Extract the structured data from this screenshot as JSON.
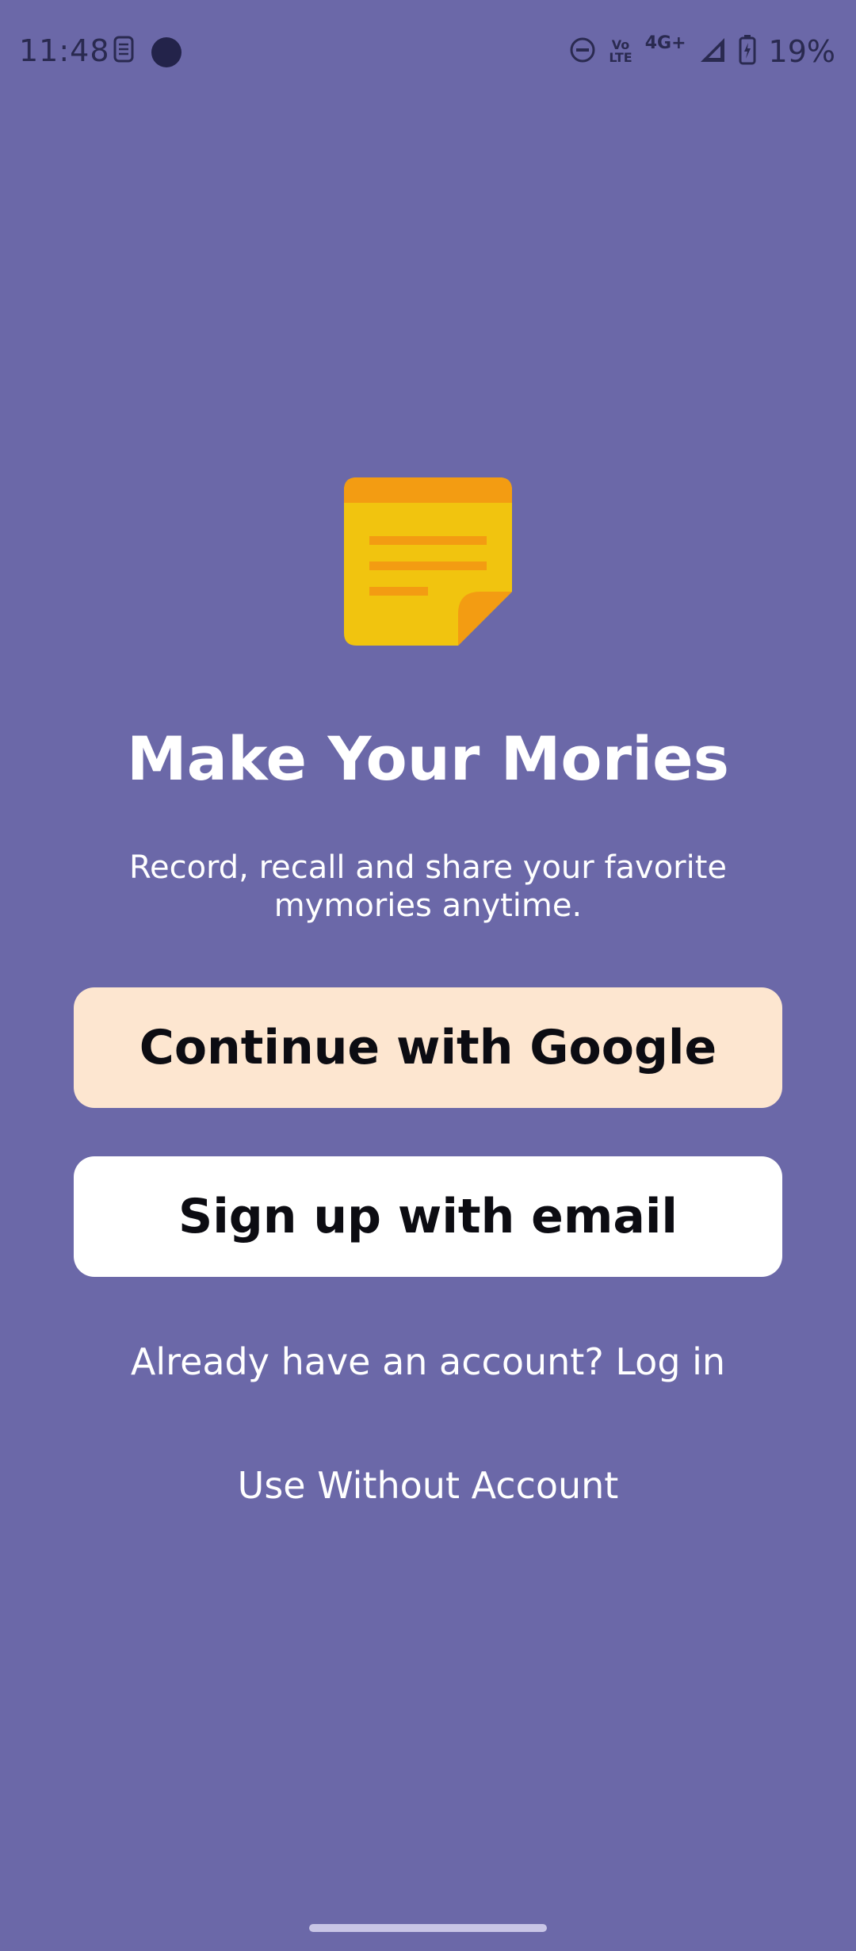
{
  "status_bar": {
    "time": "11:48",
    "network": "4G+",
    "volte_line1": "Vo",
    "volte_line2": "LTE",
    "battery": "19%",
    "icons": [
      "sim-icon",
      "recording-dot-icon",
      "do-not-disturb-icon",
      "volte-icon",
      "signal-icon",
      "battery-icon"
    ]
  },
  "logo": {
    "icon": "sticky-note-icon",
    "colors": {
      "body": "#f1c40f",
      "header": "#f39c12",
      "lines": "#f39c12",
      "fold": "#f39c12"
    }
  },
  "title": "Make Your Mories",
  "subtitle_line1": "Record, recall and share your favorite",
  "subtitle_line2": "mymories anytime.",
  "buttons": {
    "google": "Continue with Google",
    "email": "Sign up with email"
  },
  "links": {
    "login": "Already have an account? Log in",
    "guest": "Use Without Account"
  },
  "colors": {
    "background": "#6b68a8",
    "google_button": "#fde6d0",
    "email_button": "#ffffff",
    "text": "#ffffff"
  }
}
